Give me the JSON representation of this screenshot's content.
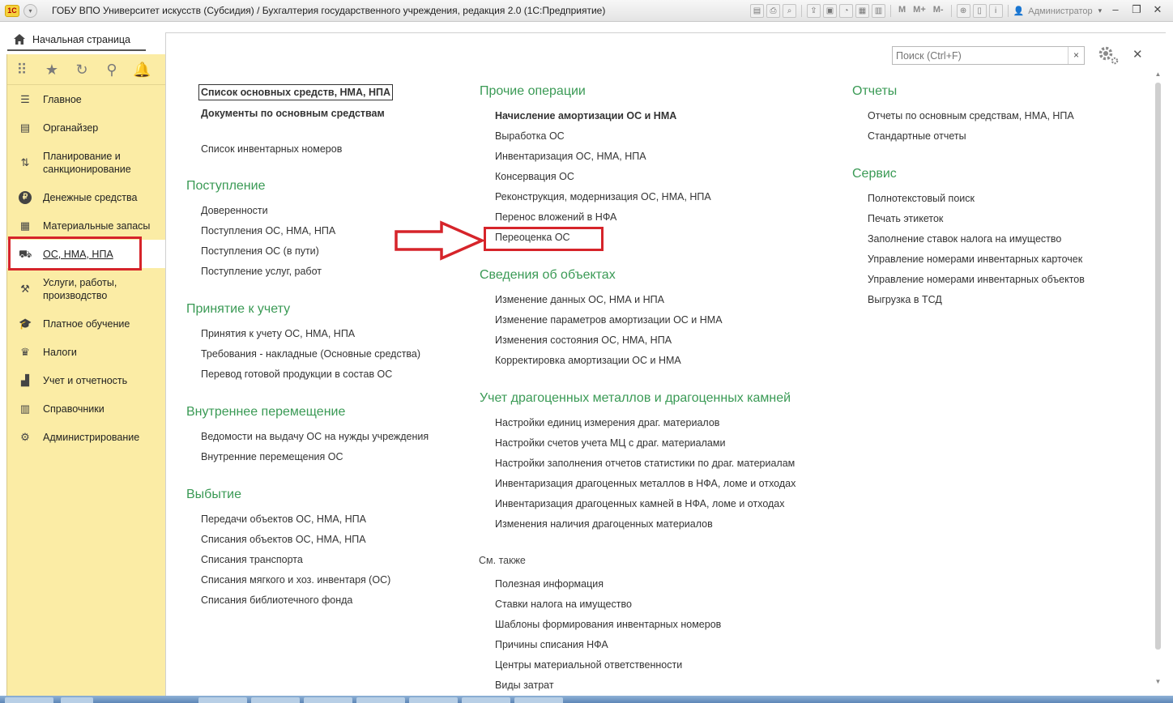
{
  "window": {
    "title": "ГОБУ ВПО Университет искусств (Субсидия) / Бухгалтерия государственного учреждения, редакция 2.0  (1С:Предприятие)",
    "logo_text": "1C",
    "user": "Администратор",
    "toolbar_text": [
      "M",
      "M+",
      "M-"
    ]
  },
  "home_tab": {
    "label": "Начальная страница"
  },
  "sidebar": {
    "items": [
      {
        "label": "Главное",
        "icon": "menu-lines-icon"
      },
      {
        "label": "Органайзер",
        "icon": "clipboard-icon"
      },
      {
        "label": "Планирование и санкционирование",
        "icon": "planning-icon"
      },
      {
        "label": "Денежные средства",
        "icon": "ruble-icon"
      },
      {
        "label": "Материальные запасы",
        "icon": "grid-icon"
      },
      {
        "label": "ОС, НМА, НПА",
        "icon": "truck-icon",
        "active": true
      },
      {
        "label": "Услуги, работы, производство",
        "icon": "tools-icon"
      },
      {
        "label": "Платное обучение",
        "icon": "graduation-cap-icon"
      },
      {
        "label": "Налоги",
        "icon": "eagle-icon"
      },
      {
        "label": "Учет и отчетность",
        "icon": "chart-icon"
      },
      {
        "label": "Справочники",
        "icon": "books-icon"
      },
      {
        "label": "Администрирование",
        "icon": "gear-icon"
      }
    ]
  },
  "search": {
    "placeholder": "Поиск (Ctrl+F)",
    "clear": "×"
  },
  "content": {
    "col1": {
      "top_links": [
        {
          "label": "Список основных средств, НМА, НПА",
          "bold": true
        },
        {
          "label": "Документы по основным средствам",
          "bold": true
        },
        {
          "label": "Список инвентарных номеров"
        }
      ],
      "sections": [
        {
          "title": "Поступление",
          "links": [
            "Доверенности",
            "Поступления ОС, НМА, НПА",
            "Поступления ОС (в пути)",
            "Поступление услуг, работ"
          ]
        },
        {
          "title": "Принятие к учету",
          "links": [
            "Принятия к учету ОС, НМА, НПА",
            "Требования - накладные (Основные средства)",
            "Перевод готовой продукции в состав ОС"
          ]
        },
        {
          "title": "Внутреннее перемещение",
          "links": [
            "Ведомости на выдачу ОС на нужды учреждения",
            "Внутренние перемещения ОС"
          ]
        },
        {
          "title": "Выбытие",
          "links": [
            "Передачи объектов ОС, НМА, НПА",
            "Списания объектов ОС, НМА, НПА",
            "Списания транспорта",
            "Списания мягкого и хоз. инвентаря (ОС)",
            "Списания библиотечного фонда"
          ]
        }
      ]
    },
    "col2": {
      "sections": [
        {
          "title": "Прочие операции",
          "links": [
            "Начисление амортизации ОС и НМА",
            "Выработка ОС",
            "Инвентаризация ОС, НМА, НПА",
            "Консервация ОС",
            "Реконструкция, модернизация ОС, НМА, НПА",
            "Перенос вложений в НФА",
            "Переоценка ОС"
          ]
        },
        {
          "title": "Сведения об объектах",
          "links": [
            "Изменение данных ОС, НМА и НПА",
            "Изменение параметров амортизации ОС и НМА",
            "Изменения состояния ОС, НМА, НПА",
            "Корректировка амортизации ОС и НМА"
          ]
        },
        {
          "title": "Учет драгоценных металлов и драгоценных камней",
          "links": [
            "Настройки единиц измерения драг. материалов",
            "Настройки счетов учета МЦ с драг. материалами",
            "Настройки заполнения отчетов статистики по драг. материалам",
            "Инвентаризация драгоценных металлов в НФА, ломе и отходах",
            "Инвентаризация драгоценных камней в НФА, ломе и отходах",
            "Изменения наличия драгоценных материалов"
          ]
        }
      ],
      "see_also": {
        "title": "См. также",
        "links": [
          "Полезная информация",
          "Ставки налога на имущество",
          "Шаблоны формирования инвентарных номеров",
          "Причины списания НФА",
          "Центры материальной ответственности",
          "Виды затрат"
        ]
      }
    },
    "col3": {
      "sections": [
        {
          "title": "Отчеты",
          "links": [
            "Отчеты по основным средствам, НМА, НПА",
            "Стандартные отчеты"
          ]
        },
        {
          "title": "Сервис",
          "links": [
            "Полнотекстовый поиск",
            "Печать этикеток",
            "Заполнение ставок налога на имущество",
            "Управление номерами инвентарных карточек",
            "Управление номерами инвентарных объектов",
            "Выгрузка в ТСД"
          ]
        }
      ]
    }
  },
  "colors": {
    "accent_green": "#3a9a55",
    "sidebar_bg": "#fbeca5",
    "highlight_red": "#d6242a"
  }
}
